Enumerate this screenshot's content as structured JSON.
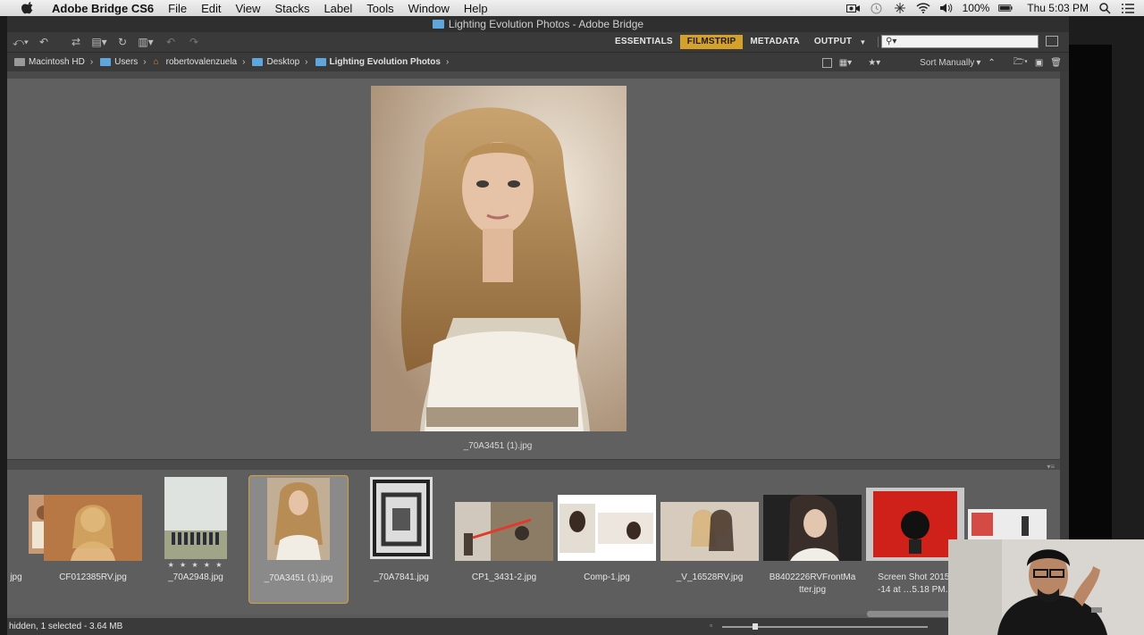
{
  "menubar": {
    "app_name": "Adobe Bridge CS6",
    "menus": [
      "File",
      "Edit",
      "View",
      "Stacks",
      "Label",
      "Tools",
      "Window",
      "Help"
    ],
    "battery": "100%",
    "clock": "Thu 5:03 PM"
  },
  "window": {
    "title": "Lighting Evolution Photos - Adobe Bridge"
  },
  "toolbar": {
    "workspaces": [
      {
        "label": "ESSENTIALS",
        "active": false
      },
      {
        "label": "FILMSTRIP",
        "active": true
      },
      {
        "label": "METADATA",
        "active": false
      },
      {
        "label": "OUTPUT",
        "active": false
      }
    ],
    "search_placeholder": ""
  },
  "breadcrumb": [
    {
      "label": "Macintosh HD",
      "icon": "hard-drive-icon"
    },
    {
      "label": "Users",
      "icon": "folder-icon"
    },
    {
      "label": "robertovalenzuela",
      "icon": "home-icon"
    },
    {
      "label": "Desktop",
      "icon": "folder-icon"
    },
    {
      "label": "Lighting Evolution Photos",
      "icon": "folder-icon"
    }
  ],
  "sort": {
    "label": "Sort Manually"
  },
  "preview": {
    "caption": "_70A3451 (1).jpg"
  },
  "filmstrip": {
    "thumbs": [
      {
        "name": "jpg",
        "stars": "",
        "selected": false,
        "swatch": "#b08060"
      },
      {
        "name": "CF012385RV.jpg",
        "stars": "",
        "selected": false,
        "swatch": "#b77845"
      },
      {
        "name": "_70A2948.jpg",
        "stars": "★ ★ ★ ★ ★",
        "selected": false,
        "swatch": "#c9ccc4"
      },
      {
        "name": "_70A3451 (1).jpg",
        "stars": "",
        "selected": true,
        "swatch": "#b49778"
      },
      {
        "name": "_70A7841.jpg",
        "stars": "",
        "selected": false,
        "swatch": "#7a7a7a"
      },
      {
        "name": "CP1_3431-2.jpg",
        "stars": "",
        "selected": false,
        "swatch": "#8c7c66"
      },
      {
        "name": "Comp-1.jpg",
        "stars": "",
        "selected": false,
        "swatch": "#e9e4de"
      },
      {
        "name": "_V_16528RV.jpg",
        "stars": "",
        "selected": false,
        "swatch": "#cfc2b4"
      },
      {
        "name": "B8402226RVFrontMatter.jpg",
        "stars": "",
        "selected": false,
        "swatch": "#333333"
      },
      {
        "name": "Screen Shot 2015-…-14 at …5.18 PM.p",
        "stars": "",
        "selected": false,
        "swatch": "#d0201a"
      },
      {
        "name": "",
        "stars": "",
        "selected": false,
        "swatch": "#e6e6e6"
      }
    ]
  },
  "status": {
    "text": "hidden, 1 selected - 3.64 MB"
  },
  "colors": {
    "active_workspace": "#d6a12a",
    "selection_border": "#d1a03a",
    "panel": "#606060"
  }
}
